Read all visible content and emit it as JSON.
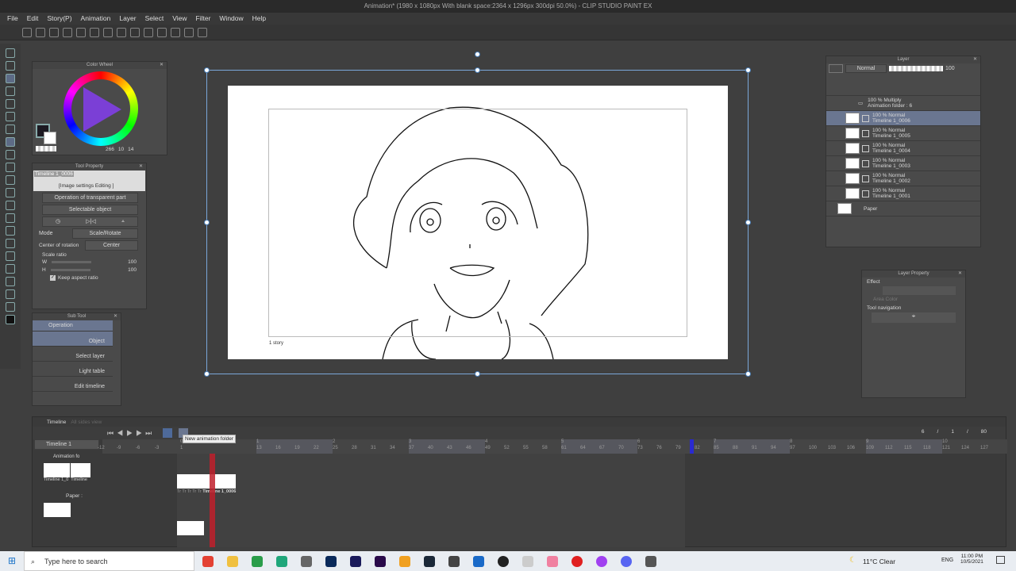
{
  "window": {
    "title": "Animation* (1980 x 1080px With blank space:2364 x 1296px 300dpi 50.0%)  - CLIP STUDIO PAINT EX"
  },
  "menu": [
    "File",
    "Edit",
    "Story(P)",
    "Animation",
    "Layer",
    "Select",
    "View",
    "Filter",
    "Window",
    "Help"
  ],
  "color_wheel": {
    "title": "Color Wheel",
    "h": "266",
    "s": "10",
    "v": "14",
    "main_color": "#1c1a22",
    "sub_color": "#ffffff"
  },
  "tool_property": {
    "title": "Tool Property",
    "preview_name": "Timeline 1_0006",
    "preview_caption": "[Image settings Editing ]",
    "operation": "Operation of transparent part",
    "selectable": "Selectable object",
    "mode_label": "Mode",
    "mode_value": "Scale/Rotate",
    "center_label": "Center of rotation",
    "center_value": "Center",
    "scale_label": "Scale ratio",
    "w_label": "W",
    "w_value": "100",
    "h_label": "H",
    "h_value": "100",
    "keep_aspect": "Keep aspect ratio"
  },
  "sub_tool": {
    "title": "Sub Tool",
    "group": "Operation",
    "items": [
      "Object",
      "Select layer",
      "Light table",
      "Edit timeline"
    ]
  },
  "canvas": {
    "story_label": "1 story"
  },
  "layer_panel": {
    "title": "Layer",
    "blend": "Normal",
    "opacity": "100",
    "folder": {
      "line1": "100 % Multiply",
      "line2": "Animation folder : 6"
    },
    "layers": [
      {
        "mode": "100 % Normal",
        "name": "Timeline 1_0006",
        "selected": true
      },
      {
        "mode": "100 % Normal",
        "name": "Timeline 1_0005"
      },
      {
        "mode": "100 % Normal",
        "name": "Timeline 1_0004"
      },
      {
        "mode": "100 % Normal",
        "name": "Timeline 1_0003"
      },
      {
        "mode": "100 % Normal",
        "name": "Timeline 1_0002"
      },
      {
        "mode": "100 % Normal",
        "name": "Timeline 1_0001"
      }
    ],
    "paper": "Paper"
  },
  "layer_property": {
    "title": "Layer Property",
    "effect": "Effect",
    "area_color": "Area Color",
    "tool_nav": "Tool navigation"
  },
  "timeline": {
    "tab": "Timeline",
    "tab2": "All sides view",
    "select": "Timeline 1",
    "tooltip": "New animation folder",
    "current": "6",
    "start": "1",
    "end": "80",
    "track1": "Animation fo",
    "track1_thumbs": [
      "Timeline 1_0",
      "Timeline"
    ],
    "track2": "Paper :",
    "cel_label": "Timeline 1_0006",
    "cel_marks": "Tr Tr Tr Tr Tr",
    "ruler_frames": [
      -12,
      -9,
      -6,
      -3,
      1,
      13,
      16,
      19,
      22,
      25,
      28,
      31,
      34,
      37,
      40,
      43,
      46,
      49,
      52,
      55,
      58,
      61,
      64,
      67,
      70,
      73,
      76,
      79,
      82,
      85,
      88,
      91,
      94,
      97,
      100,
      103,
      106,
      109,
      112,
      115,
      118,
      121,
      124,
      127
    ],
    "seconds": [
      "0",
      "1",
      "2",
      "3",
      "4",
      "5",
      "6",
      "7",
      "8",
      "9",
      "10"
    ]
  },
  "taskbar": {
    "search": "Type here to search",
    "weather": "11°C  Clear",
    "lang": "ENG",
    "time": "11:00 PM",
    "date": "10/5/2021"
  }
}
